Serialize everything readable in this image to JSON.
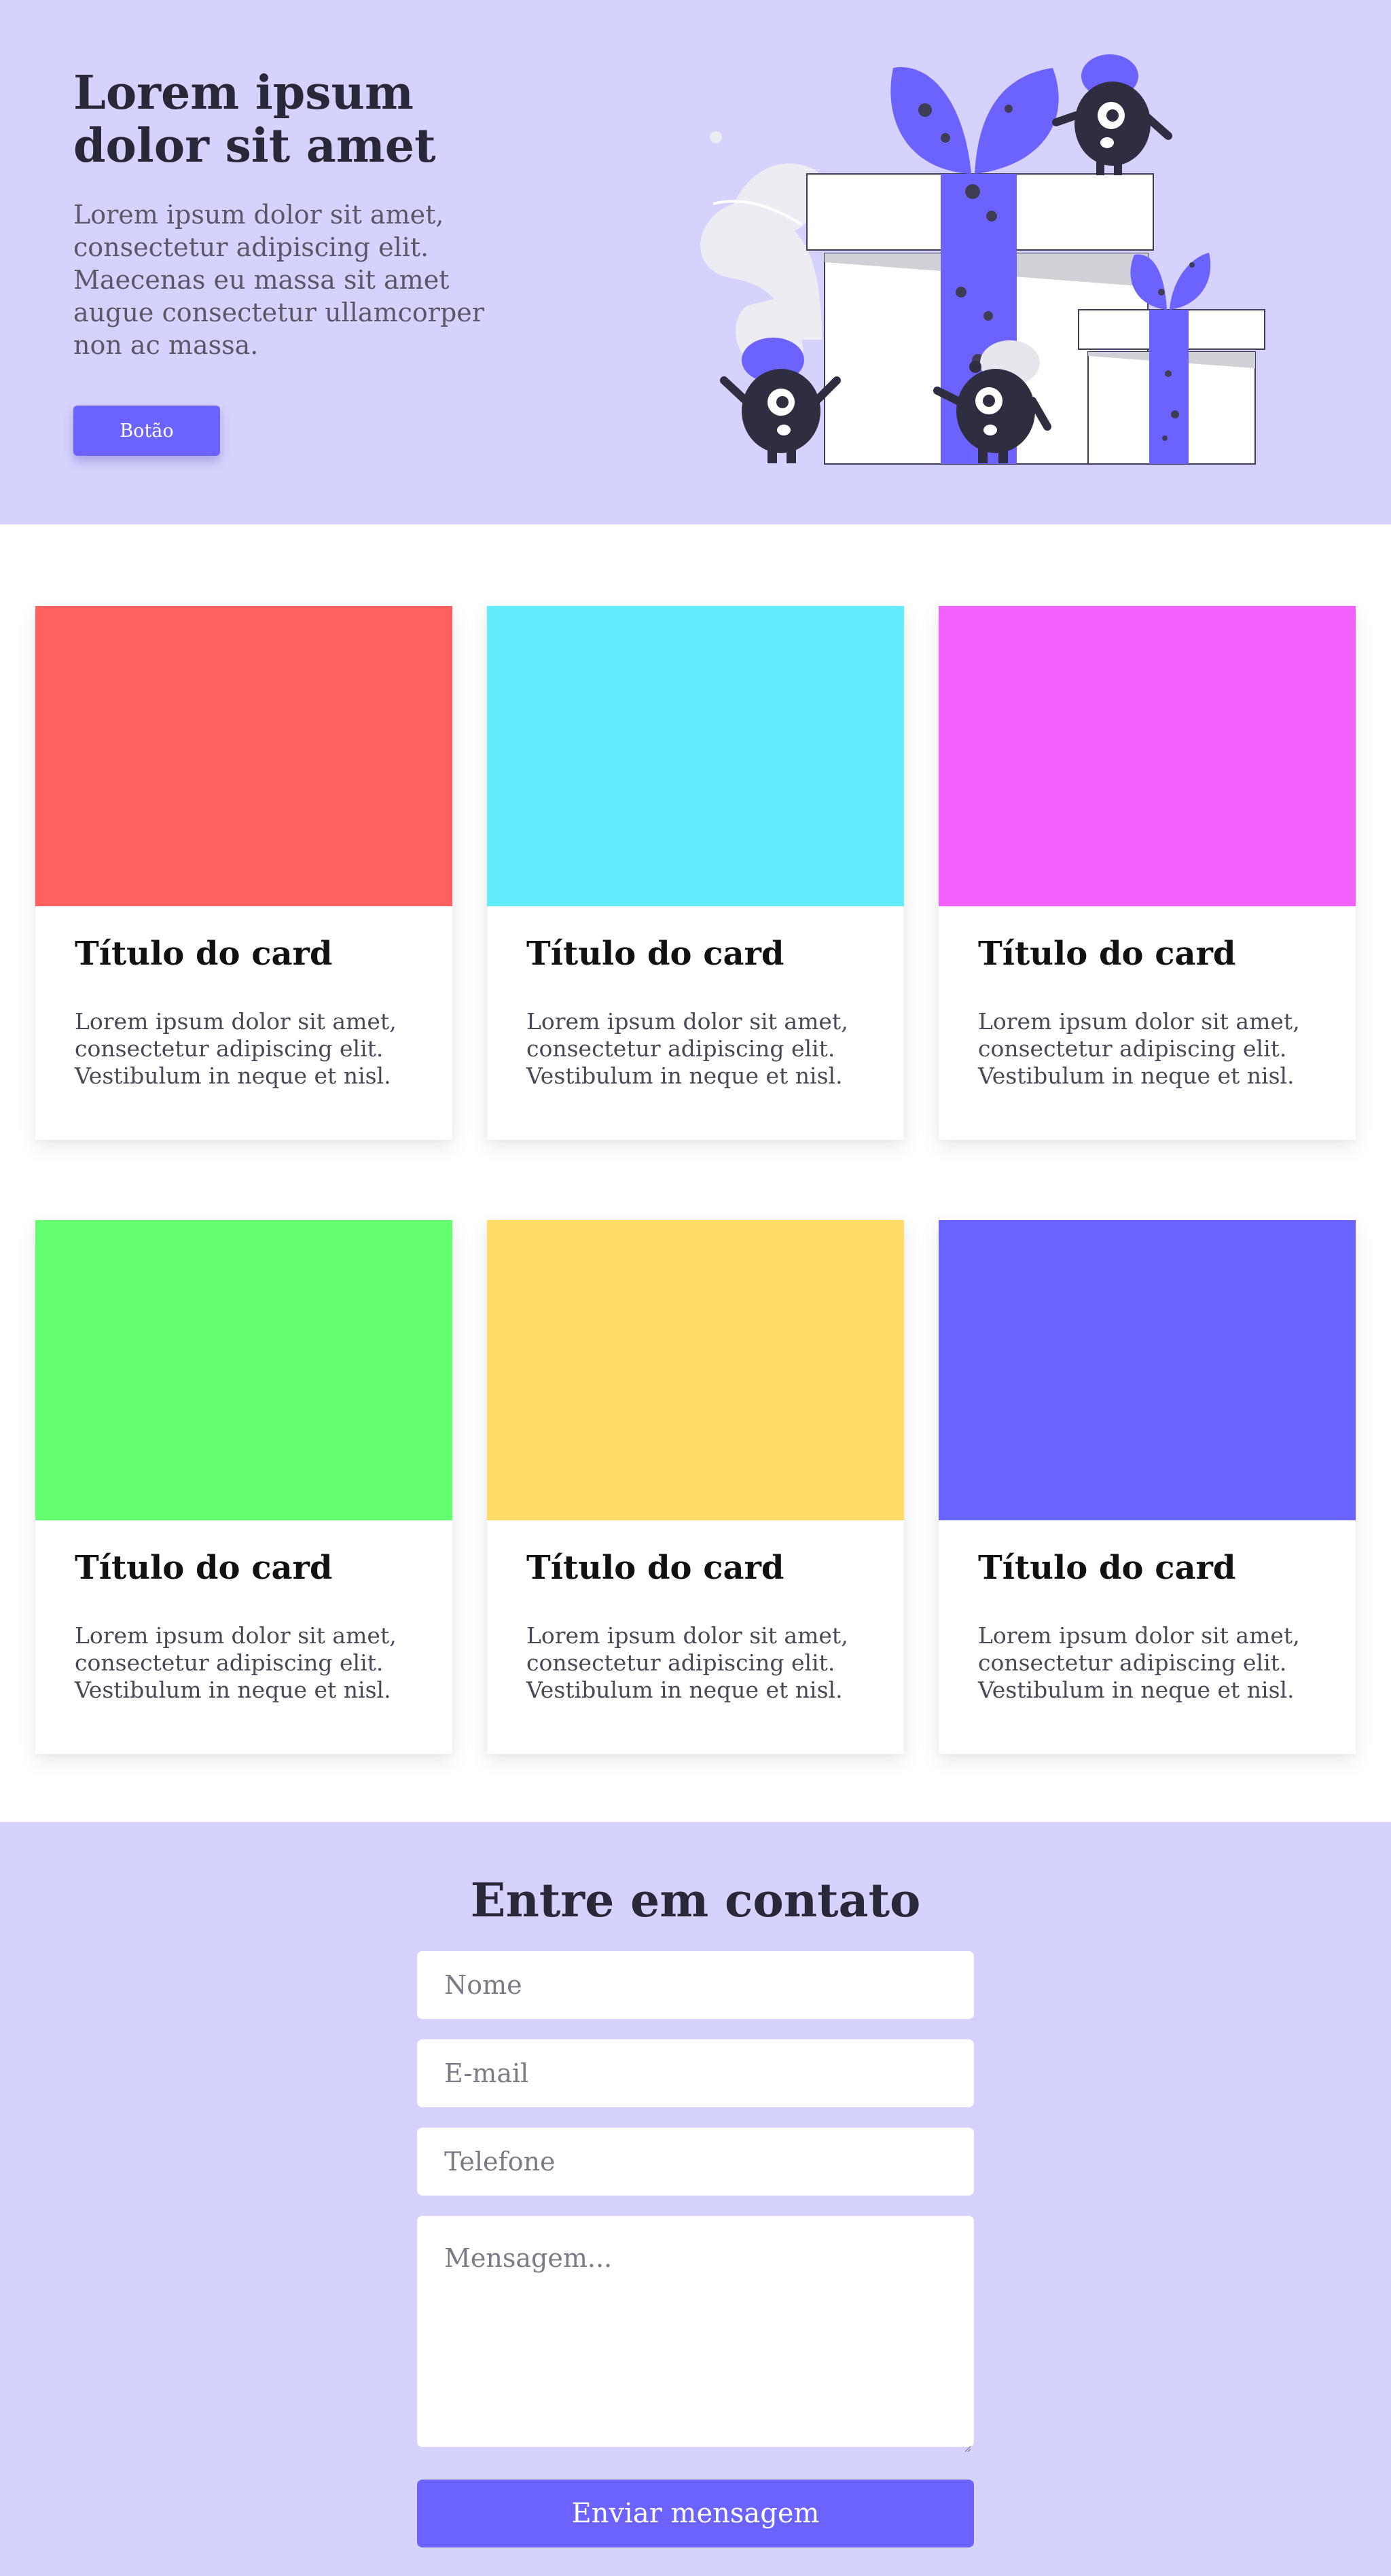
{
  "colors": {
    "hero_bg": "#d5d2fd",
    "accent": "#6c63ff",
    "text_dark": "#2a2838",
    "text_muted": "#5a5866"
  },
  "hero": {
    "title": "Lorem ipsum dolor sit amet",
    "description": "Lorem ipsum dolor sit amet, consectetur adipiscing elit. Maecenas eu massa sit amet augue consectetur ullamcorper non ac massa.",
    "button_label": "Botão",
    "illustration_icon": "gift-boxes-with-monsters-illustration"
  },
  "cards": [
    {
      "color": "#ff6161",
      "title": "Título do card",
      "text": "Lorem ipsum dolor sit amet, consectetur adipiscing elit. Vestibulum in neque et nisl."
    },
    {
      "color": "#61ebfd",
      "title": "Título do card",
      "text": "Lorem ipsum dolor sit amet, consectetur adipiscing elit. Vestibulum in neque et nisl."
    },
    {
      "color": "#f361fd",
      "title": "Título do card",
      "text": "Lorem ipsum dolor sit amet, consectetur adipiscing elit. Vestibulum in neque et nisl."
    },
    {
      "color": "#63ff6e",
      "title": "Título do card",
      "text": "Lorem ipsum dolor sit amet, consectetur adipiscing elit. Vestibulum in neque et nisl."
    },
    {
      "color": "#ffdc66",
      "title": "Título do card",
      "text": "Lorem ipsum dolor sit amet, consectetur adipiscing elit. Vestibulum in neque et nisl."
    },
    {
      "color": "#6963ff",
      "title": "Título do card",
      "text": "Lorem ipsum dolor sit amet, consectetur adipiscing elit. Vestibulum in neque et nisl."
    }
  ],
  "contact": {
    "title": "Entre em contato",
    "name_placeholder": "Nome",
    "email_placeholder": "E-mail",
    "phone_placeholder": "Telefone",
    "message_placeholder": "Mensagem...",
    "submit_label": "Enviar mensagem"
  }
}
